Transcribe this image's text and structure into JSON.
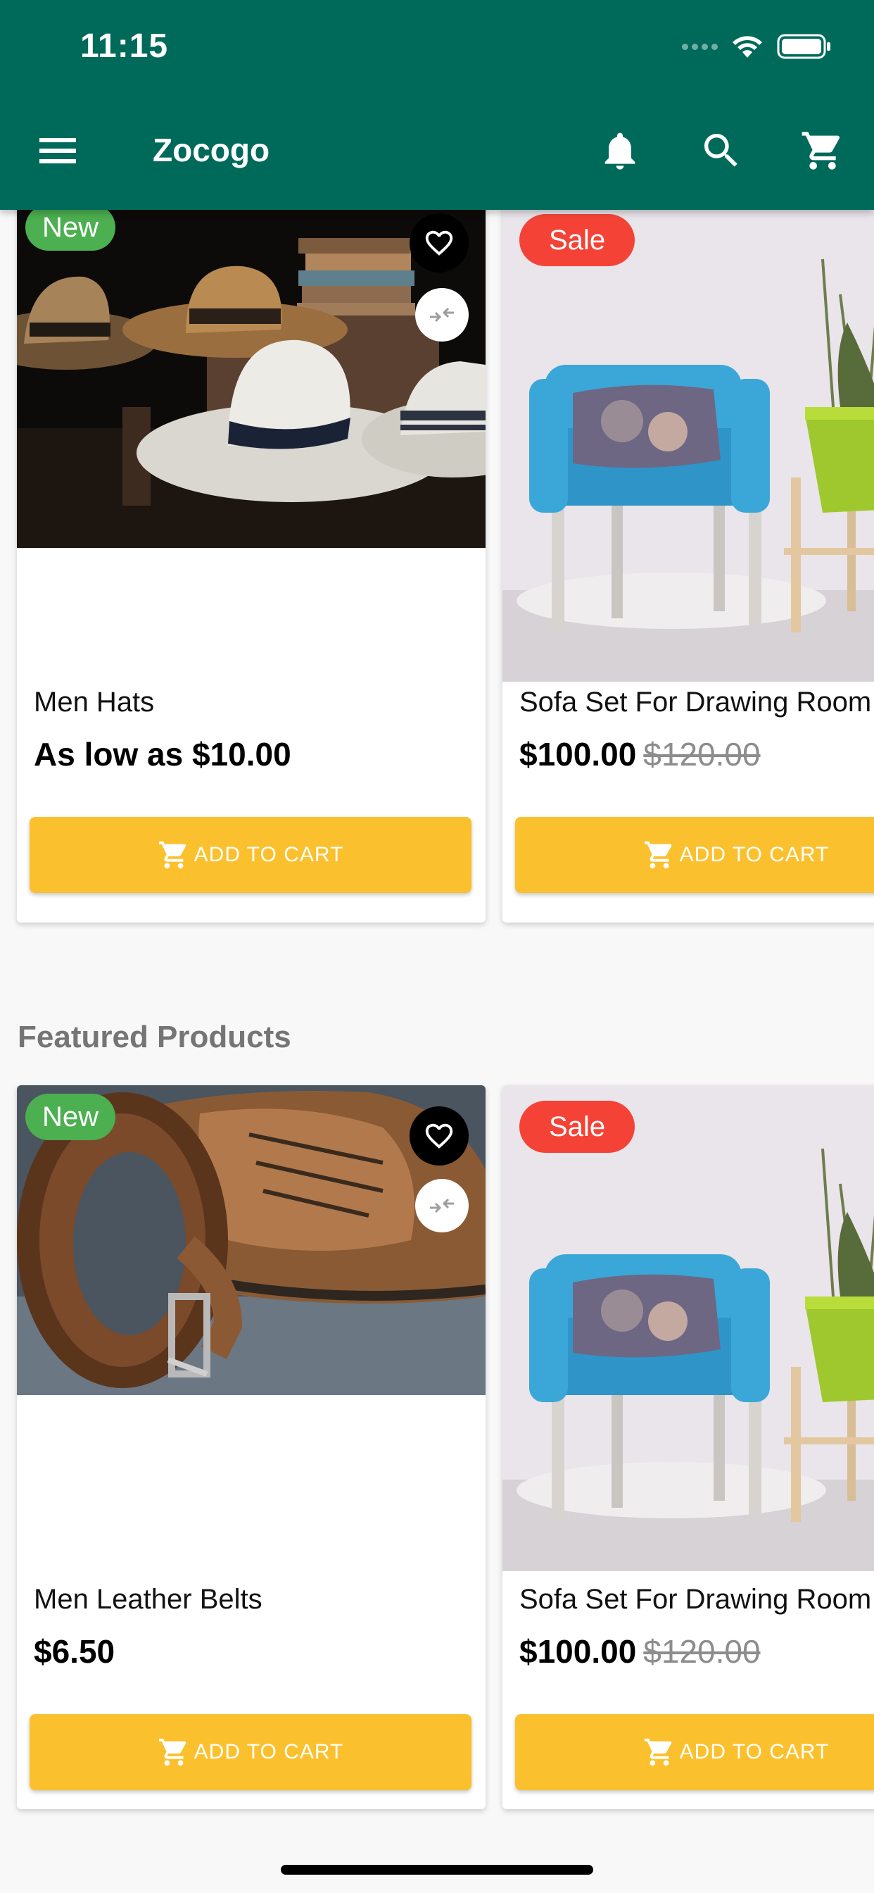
{
  "status_bar": {
    "time": "11:15"
  },
  "app_bar": {
    "title": "Zocogo",
    "colors": {
      "primary": "#006a5a"
    }
  },
  "sections": [
    {
      "title": "",
      "products": [
        {
          "name": "Men Hats",
          "price": "As low as $10.00",
          "old_price": "",
          "badge": "New",
          "add_label": "ADD TO CART"
        },
        {
          "name": "Sofa Set For Drawing Room",
          "price": "$100.00",
          "old_price": "$120.00",
          "badge": "Sale",
          "add_label": "ADD TO CART"
        }
      ]
    },
    {
      "title": "Featured Products",
      "products": [
        {
          "name": "Men Leather Belts",
          "price": "$6.50",
          "old_price": "",
          "badge": "New",
          "add_label": "ADD TO CART"
        },
        {
          "name": "Sofa Set For Drawing Room",
          "price": "$100.00",
          "old_price": "$120.00",
          "badge": "Sale",
          "add_label": "ADD TO CART"
        }
      ]
    }
  ],
  "colors": {
    "badge_new": "#4caf50",
    "badge_sale": "#f44336",
    "add_button": "#fbc02d"
  }
}
